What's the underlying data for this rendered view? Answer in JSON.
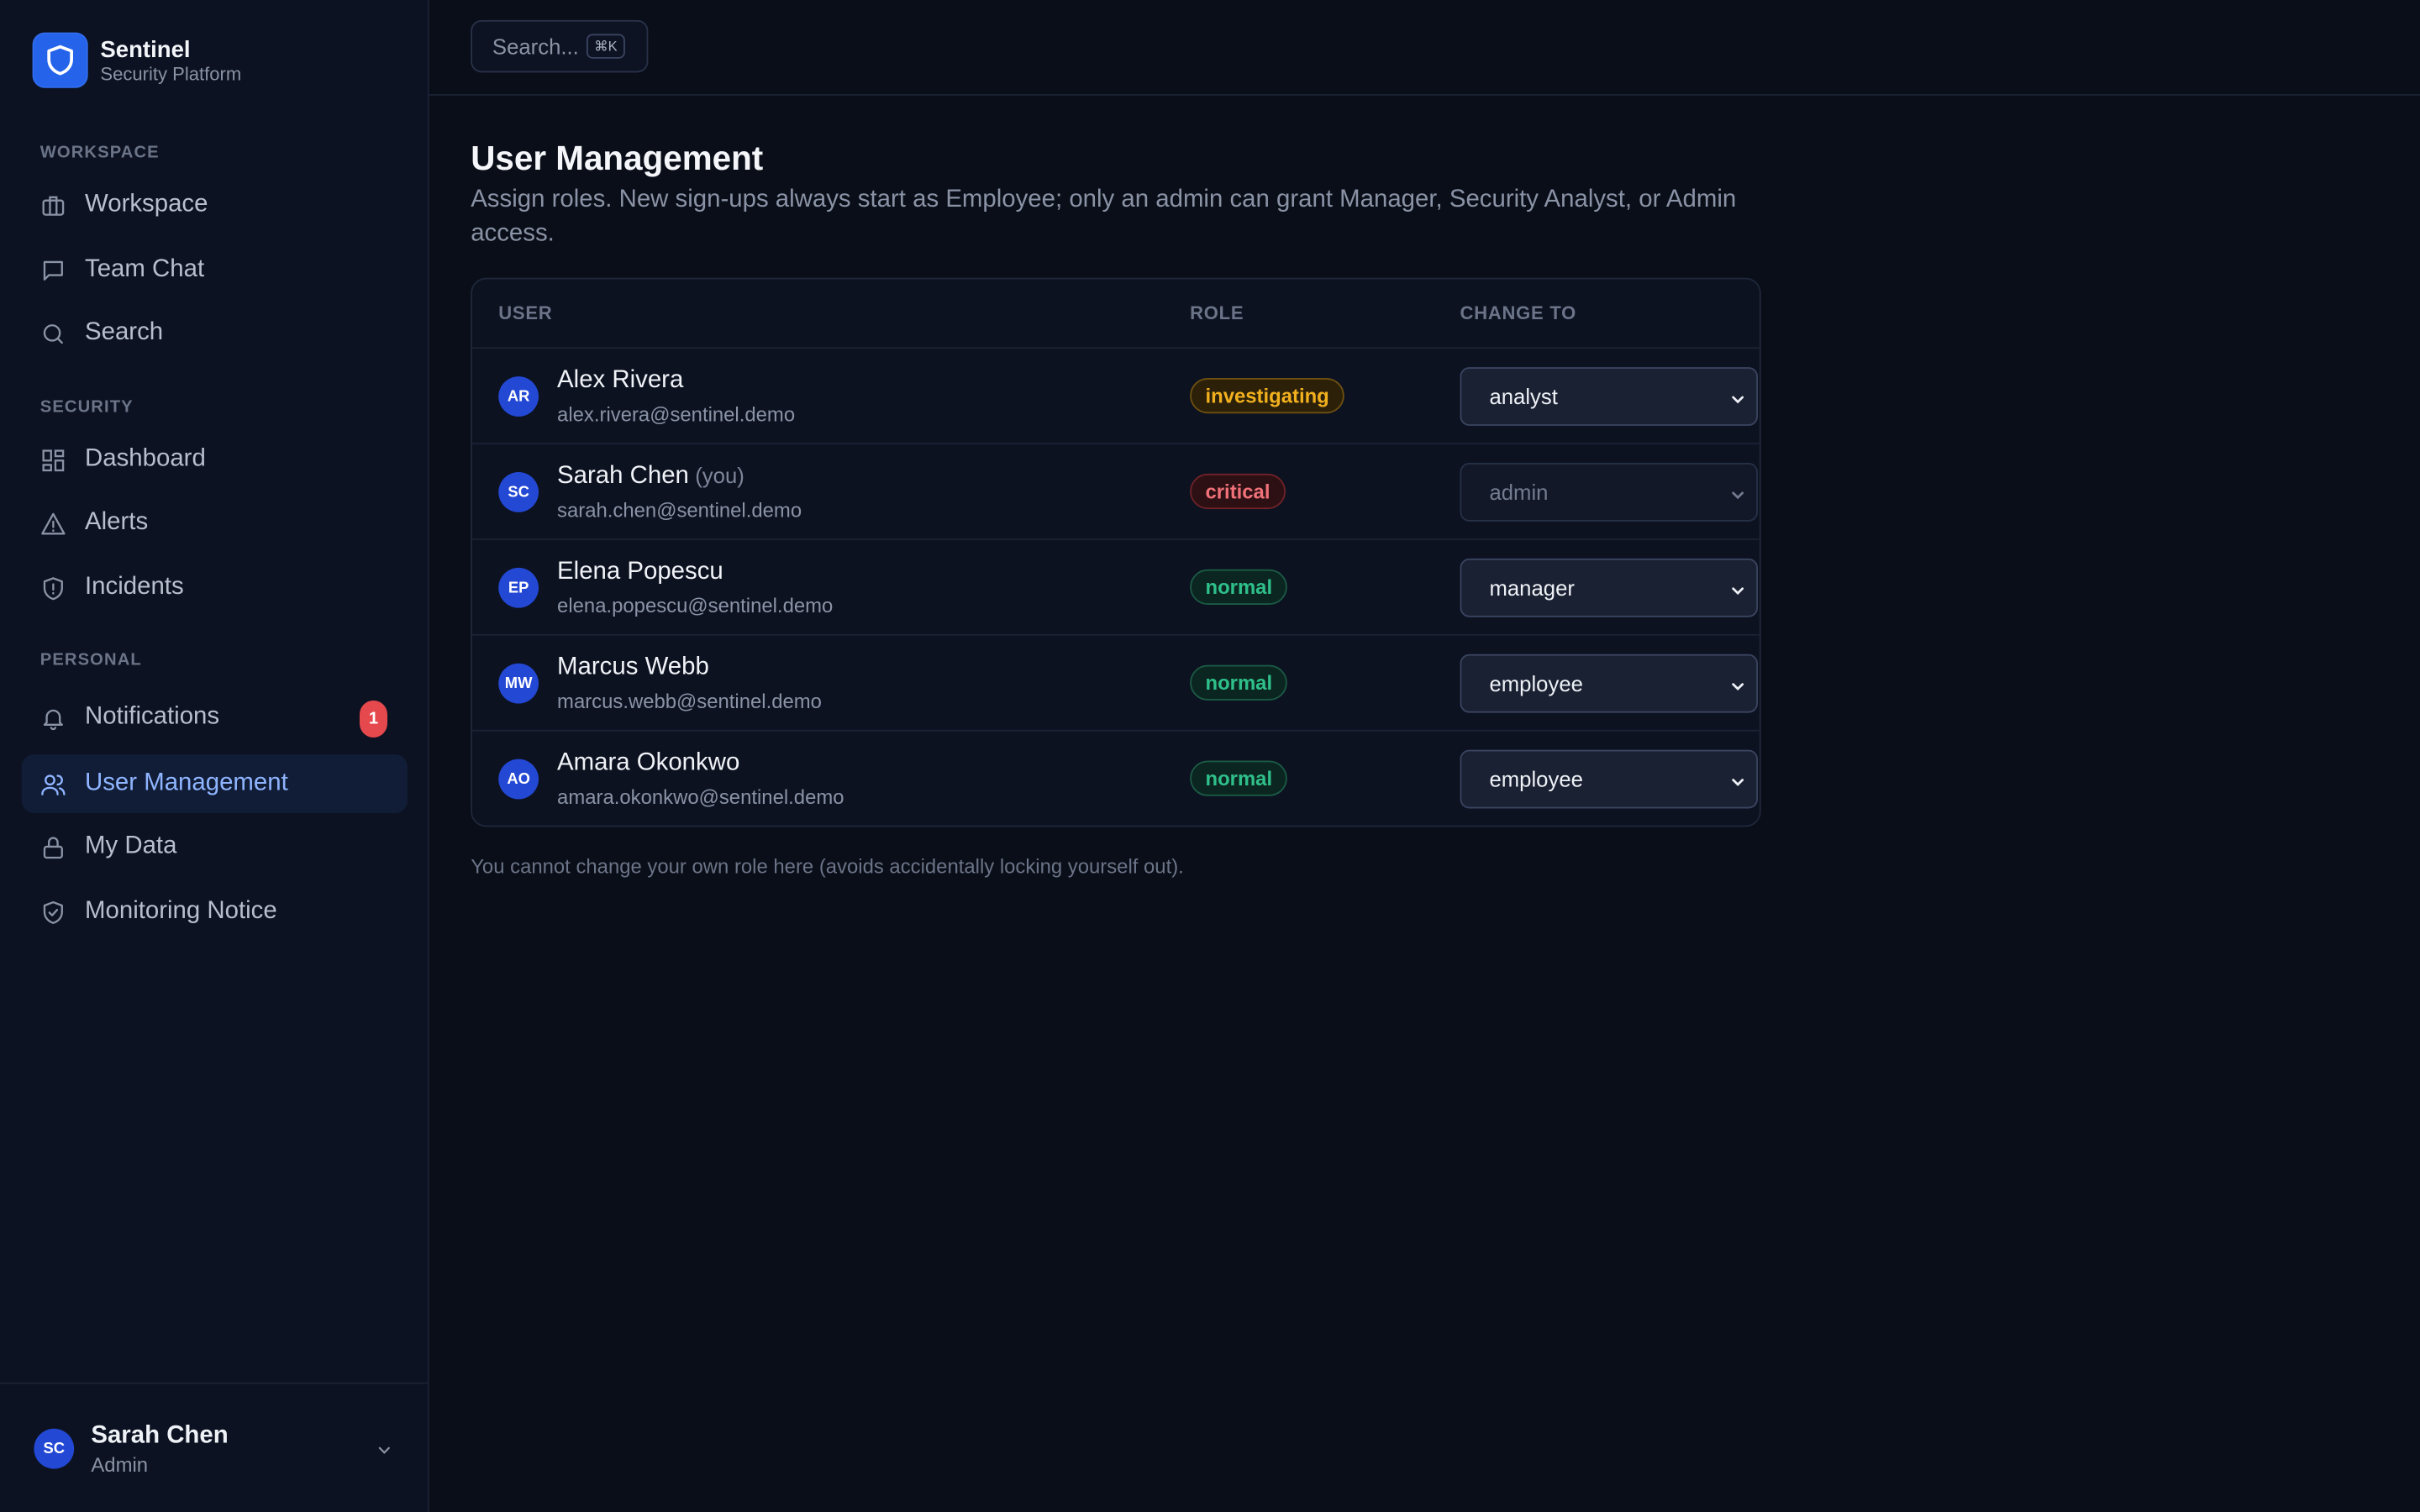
{
  "brand": {
    "name": "Sentinel",
    "subtitle": "Security Platform"
  },
  "sidebar": {
    "sections": [
      {
        "label": "WORKSPACE",
        "items": [
          {
            "label": "Workspace",
            "icon": "briefcase-icon"
          },
          {
            "label": "Team Chat",
            "icon": "chat-icon"
          },
          {
            "label": "Search",
            "icon": "search-icon"
          }
        ]
      },
      {
        "label": "SECURITY",
        "items": [
          {
            "label": "Dashboard",
            "icon": "dashboard-icon"
          },
          {
            "label": "Alerts",
            "icon": "warning-icon"
          },
          {
            "label": "Incidents",
            "icon": "shield-alert-icon"
          }
        ]
      },
      {
        "label": "PERSONAL",
        "items": [
          {
            "label": "Notifications",
            "icon": "bell-icon",
            "badge": "1"
          },
          {
            "label": "User Management",
            "icon": "users-icon",
            "active": true
          },
          {
            "label": "My Data",
            "icon": "lock-icon"
          },
          {
            "label": "Monitoring Notice",
            "icon": "shield-check-icon"
          }
        ]
      }
    ]
  },
  "current_user": {
    "initials": "SC",
    "name": "Sarah Chen",
    "role": "Admin"
  },
  "topbar": {
    "search_placeholder": "Search...",
    "shortcut": "⌘K"
  },
  "page": {
    "title": "User Management",
    "description": "Assign roles. New sign-ups always start as Employee; only an admin can grant Manager, Security Analyst, or Admin access.",
    "footnote": "You cannot change your own role here (avoids accidentally locking yourself out)."
  },
  "table": {
    "columns": [
      "USER",
      "ROLE",
      "CHANGE TO"
    ],
    "rows": [
      {
        "initials": "AR",
        "name": "Alex Rivera",
        "you": "",
        "email": "alex.rivera@sentinel.demo",
        "status": "investigating",
        "role_select": "analyst",
        "disabled": false
      },
      {
        "initials": "SC",
        "name": "Sarah Chen",
        "you": "(you)",
        "email": "sarah.chen@sentinel.demo",
        "status": "critical",
        "role_select": "admin",
        "disabled": true
      },
      {
        "initials": "EP",
        "name": "Elena Popescu",
        "you": "",
        "email": "elena.popescu@sentinel.demo",
        "status": "normal",
        "role_select": "manager",
        "disabled": false
      },
      {
        "initials": "MW",
        "name": "Marcus Webb",
        "you": "",
        "email": "marcus.webb@sentinel.demo",
        "status": "normal",
        "role_select": "employee",
        "disabled": false
      },
      {
        "initials": "AO",
        "name": "Amara Okonkwo",
        "you": "",
        "email": "amara.okonkwo@sentinel.demo",
        "status": "normal",
        "role_select": "employee",
        "disabled": false
      }
    ]
  },
  "colors": {
    "accent": "#2563eb",
    "active_nav_bg": "#111d37",
    "active_nav_text": "#8fb4ff",
    "badge": "#e5484d",
    "investigating": "#f2b01e",
    "critical": "#f07178",
    "normal": "#2fbf8a"
  }
}
